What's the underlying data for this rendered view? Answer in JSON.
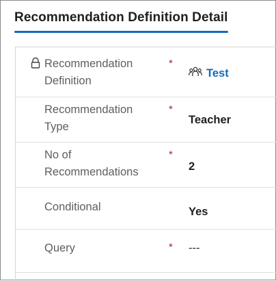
{
  "header": {
    "title": "Recommendation Definition Detail"
  },
  "fields": [
    {
      "label": "Recommendation Definition",
      "required": "*",
      "value": "Test",
      "locked": true,
      "value_icon": "people-icon"
    },
    {
      "label": "Recommendation Type",
      "required": "*",
      "value": "Teacher"
    },
    {
      "label": "No of Recommendations",
      "required": "*",
      "value": "2"
    },
    {
      "label": "Conditional",
      "value": "Yes"
    },
    {
      "label": "Query",
      "required": "*",
      "value": "---"
    }
  ],
  "colors": {
    "accent": "#0f6cbd",
    "required": "#a4262c"
  }
}
